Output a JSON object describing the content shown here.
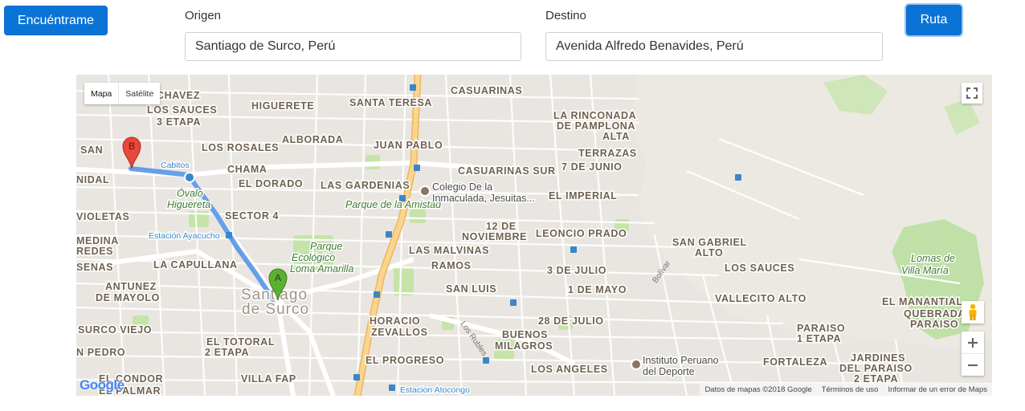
{
  "toolbar": {
    "locate_label": "Encuéntrame",
    "route_label": "Ruta"
  },
  "origin": {
    "label": "Origen",
    "value": "Santiago de Surco, Perú"
  },
  "destination": {
    "label": "Destino",
    "value": "Avenida Alfredo Benavides, Perú"
  },
  "map": {
    "type_control": {
      "map": "Mapa",
      "satellite": "Satélite"
    },
    "markers": {
      "start": "A",
      "end": "B"
    },
    "districts": [
      "CHAVEZ",
      "LOS SAUCES",
      "3 ETAPA",
      "HIGUERETE",
      "SANTA TERESA",
      "CASUARINAS",
      "LA RINCONADA",
      "DE PAMPLONA",
      "ALTA",
      "SAN",
      "NIDAL",
      "LOS ROSALES",
      "ALBORADA",
      "JUAN PABLO",
      "TERRAZAS",
      "7 DE JUNIO",
      "CASUARINAS SUR",
      "CHAMA",
      "EL DORADO",
      "LAS GARDENIAS",
      "EL IMPERIAL",
      "VIOLETAS",
      "SECTOR 4",
      "12 DE",
      "NOVIEMBRE",
      "LEONCIO PRADO",
      "SAN GABRIEL",
      "ALTO",
      "MEDINA",
      "REDES",
      "LA CAPULLANA",
      "LAS MALVINAS",
      "RAMOS",
      "3 DE JULIO",
      "LOS SAUCES",
      "SENAS",
      "ANTUNEZ",
      "DE MAYOLO",
      "SAN LUIS",
      "1 DE MAYO",
      "VALLECITO ALTO",
      "EL MANANTIAL",
      "QUEBRADA",
      "PARAISO",
      "SURCO VIEJO",
      "HORACIO",
      "ZEVALLOS",
      "28 DE JULIO",
      "BUENOS",
      "MILAGROS",
      "PARAISO",
      "1 ETAPA",
      "N PEDRO",
      "EL TOTORAL",
      "2 ETAPA",
      "EL PROGRESO",
      "LOS ANGELES",
      "FORTALEZA",
      "JARDINES",
      "DEL PARAISO",
      "2 ETAPA",
      "EL CONDOR",
      "EL PALMAR",
      "VILLA FAP"
    ],
    "parks": [
      "Óvalo",
      "Higuereta",
      "Parque de la Amistad",
      "Parque",
      "Ecológico",
      "Loma Amarilla",
      "Lomas de",
      "Villa María"
    ],
    "big_label": [
      "Santiago",
      "de Surco"
    ],
    "pois": [
      "Colegio De la",
      "Inmaculada, Jesuitas...",
      "Instituto Peruano",
      "del Deporte"
    ],
    "transit": [
      "Cabitos",
      "Estación Ayacucho",
      "Estacion Atocongo"
    ],
    "roads": [
      "Los Rubles",
      "Bolívar"
    ],
    "logo": "Google",
    "attribution": [
      "Datos de mapas ©2018 Google",
      "Términos de uso",
      "Informar de un error de Maps"
    ]
  },
  "colors": {
    "accent": "#0a74d6",
    "route": "#5aa0f0",
    "marker_a": "#5ab031",
    "marker_b": "#e8473c",
    "highway": "#f5c572"
  }
}
